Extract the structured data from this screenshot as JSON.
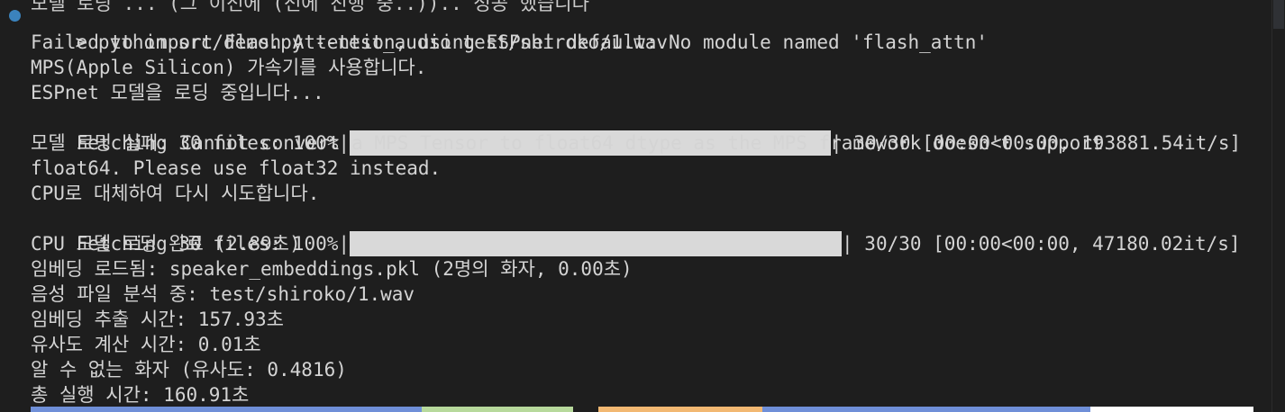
{
  "clipped_top_text": "모델 로딩 ... (그 이전에 (전에 진행 중..)).. 성공 했습니다",
  "prompt": {
    "symbol": ">",
    "command": "python src/demo.py --test_audio test/shiroko/1.wav"
  },
  "output": [
    {
      "text": "Failed to import Flash Attention, using ESPnet default: No module named 'flash_attn'"
    },
    {
      "text": "MPS(Apple Silicon) 가속기를 사용합니다."
    },
    {
      "text": "ESPnet 모델을 로딩 중입니다..."
    },
    {
      "prefix": "Fetching 30 files: 100%|",
      "suffix": "| 30/30 [00:00<00:00, 193881.54it/s]",
      "progress": 1.0
    },
    {
      "text": "모델 로딩 실패: Cannot convert a MPS Tensor to float64 dtype as the MPS framework doesn't support"
    },
    {
      "text": "float64. Please use float32 instead."
    },
    {
      "text": "CPU로 대체하여 다시 시도합니다."
    },
    {
      "prefix": "Fetching 30 files: 100%|",
      "suffix": "| 30/30 [00:00<00:00, 47180.02it/s]",
      "progress": 1.0
    },
    {
      "text": "CPU 모델 로딩 완료 (2.89초)"
    },
    {
      "text": "임베딩 로드됨: speaker_embeddings.pkl (2명의 화자, 0.00초)"
    },
    {
      "text": "음성 파일 분석 중: test/shiroko/1.wav"
    },
    {
      "text": "임베딩 추출 시간: 157.93초"
    },
    {
      "text": "유사도 계산 시간: 0.01초"
    },
    {
      "text": "알 수 없는 화자 (유사도: 0.4816)"
    },
    {
      "text": "총 실행 시간: 160.91초"
    }
  ],
  "colors": {
    "background": "#1e1e1e",
    "text": "#d4d4d4",
    "prompt_dot": "#3b83bd",
    "progress_fill": "#d9d9d9",
    "strip": [
      "#6f8fd8",
      "#b7d99c",
      "#1e1e1e",
      "#f2b872",
      "#6f8fd8",
      "#ffffff",
      "#1e1e1e"
    ]
  }
}
